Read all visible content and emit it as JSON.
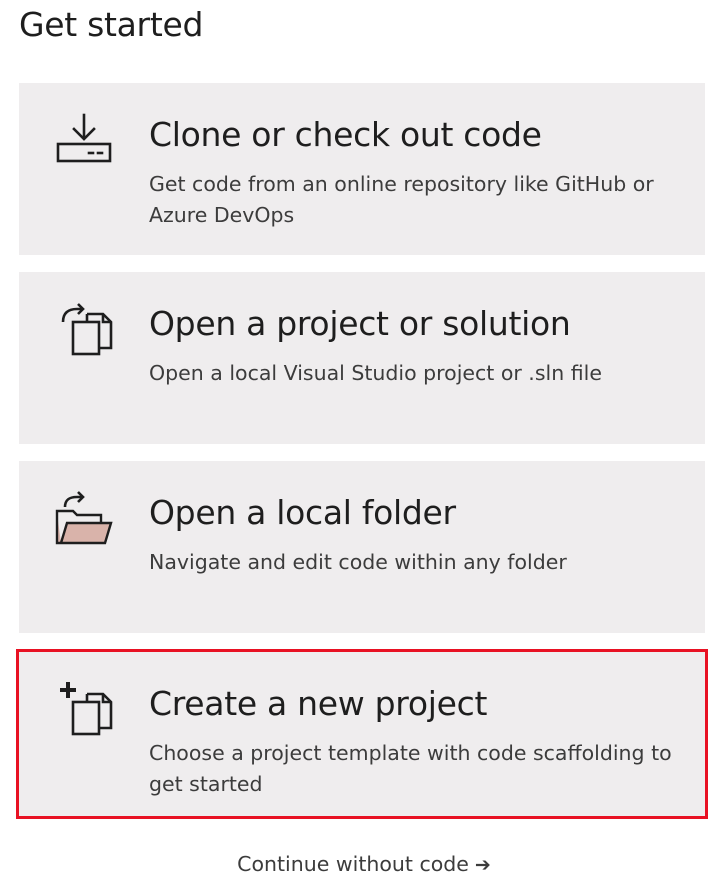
{
  "heading": "Get started",
  "cards": [
    {
      "title": "Clone or check out code",
      "description": "Get code from an online repository like GitHub or Azure DevOps",
      "icon": "clone-download-icon"
    },
    {
      "title": "Open a project or solution",
      "description": "Open a local Visual Studio project or .sln file",
      "icon": "open-project-icon"
    },
    {
      "title": "Open a local folder",
      "description": "Navigate and edit code within any folder",
      "icon": "open-folder-icon"
    },
    {
      "title": "Create a new project",
      "description": "Choose a project template with code scaffolding to get started",
      "icon": "new-project-icon",
      "selected": true
    }
  ],
  "continue": {
    "label": "Continue without code",
    "arrow": "➔"
  },
  "colors": {
    "card_background": "#efedee",
    "selection_outline": "#e81123",
    "folder_fill": "#d9b3aa"
  }
}
